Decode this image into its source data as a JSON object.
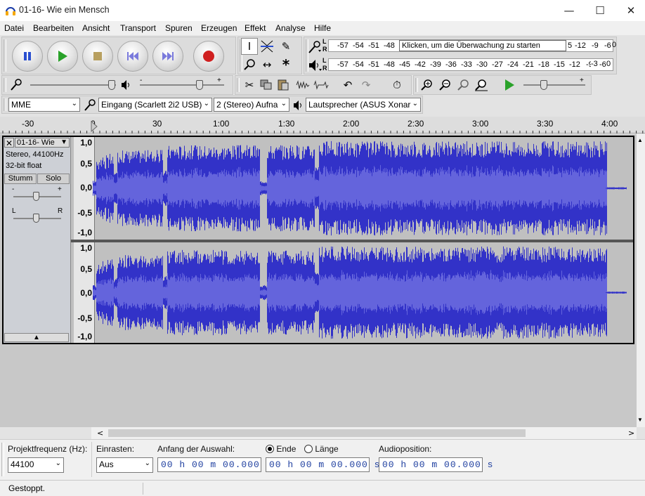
{
  "window": {
    "title": "01-16- Wie ein Mensch"
  },
  "menu": [
    "Datei",
    "Bearbeiten",
    "Ansicht",
    "Transport",
    "Spuren",
    "Erzeugen",
    "Effekt",
    "Analyse",
    "Hilfe"
  ],
  "meters": {
    "record_scale": [
      "-57",
      "-54",
      "-51",
      "-48",
      "-",
      "5",
      "-12",
      "-9",
      "-6",
      "-3",
      "0"
    ],
    "tooltip": "Klicken, um die Überwachung zu starten",
    "play_scale": [
      "-57",
      "-54",
      "-51",
      "-48",
      "-45",
      "-42",
      "-39",
      "-36",
      "-33",
      "-30",
      "-27",
      "-24",
      "-21",
      "-18",
      "-15",
      "-12",
      "-9",
      "-6",
      "-3",
      "0"
    ],
    "lr": [
      "L",
      "R"
    ]
  },
  "devices": {
    "host": "MME",
    "input": "Eingang (Scarlett 2i2 USB)",
    "channels": "2 (Stereo) Aufna",
    "output": "Lautsprecher (ASUS Xonar"
  },
  "ruler": [
    "-30",
    "0",
    "30",
    "1:00",
    "1:30",
    "2:00",
    "2:30",
    "3:00",
    "3:30",
    "4:00"
  ],
  "track": {
    "name": "01-16- Wie",
    "format": "Stereo, 44100Hz",
    "bits": "32-bit float",
    "mute": "Stumm",
    "solo": "Solo",
    "gain_minus": "-",
    "gain_plus": "+",
    "pan_left": "L",
    "pan_right": "R"
  },
  "scale": [
    "1,0",
    "0,5",
    "0,0",
    "-0,5",
    "-1,0"
  ],
  "bottom": {
    "rate_label": "Projektfrequenz (Hz):",
    "rate": "44100",
    "snap_label": "Einrasten:",
    "snap": "Aus",
    "sel_start_label": "Anfang der Auswahl:",
    "end_label": "Ende",
    "length_label": "Länge",
    "audio_pos_label": "Audioposition:",
    "time": "00 h 00 m 00.000 s"
  },
  "status": "Gestoppt.",
  "colors": {
    "wave_dark": "#3232c8",
    "wave_light": "#6464dc",
    "track_bg": "#c0c0c0"
  }
}
